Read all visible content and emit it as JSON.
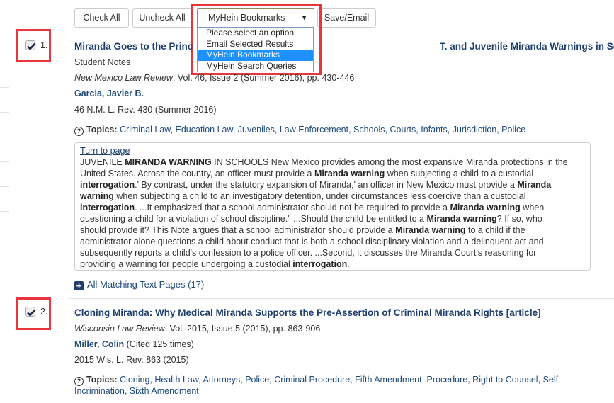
{
  "toolbar": {
    "check_all": "Check All",
    "uncheck_all": "Uncheck All",
    "select_value": "MyHein Bookmarks",
    "save_email": "Save/Email",
    "options": [
      {
        "label": "Please select an option",
        "selected": false
      },
      {
        "label": "Email Selected Results",
        "selected": false
      },
      {
        "label": "MyHein Bookmarks",
        "selected": true
      },
      {
        "label": "MyHein Search Queries",
        "selected": false
      }
    ]
  },
  "results": [
    {
      "number": "1.",
      "checked": true,
      "title": "Miranda Goes to the Principal's Office: The Supreme Court of New Mexico in State v. Antonio T. and Juvenile Miranda Warnings in Schools [notes]",
      "title_visible_left": "Miranda Goes to the Princ",
      "title_visible_right": "T. and Juvenile Miranda Warnings in Schools [notes]",
      "section": "Student Notes",
      "journal": "New Mexico Law Review",
      "journal_rest": ", Vol. 46, Issue 2 (Summer 2016), pp. 430-446",
      "author": "Garcia, Javier B.",
      "citation": "46 N.M. L. Rev. 430 (Summer 2016)",
      "topics_label": "Topics:",
      "topics": "Criminal Law, Education Law, Juveniles, Law Enforcement, Schools, Courts, Infants, Jurisdiction, Police",
      "turn_to_page": "Turn to page",
      "snippet_lines": [
        [
          [
            "JUVENILE ",
            false
          ],
          [
            "MIRANDA WARNING",
            true
          ],
          [
            " IN SCHOOLS New Mexico provides among the most expansive Miranda protections in the",
            false
          ]
        ],
        [
          [
            "United States. Across the country, an officer must provide a ",
            false
          ],
          [
            "Miranda warning",
            true
          ],
          [
            " when subjecting a child to a custodial",
            false
          ]
        ],
        [
          [
            "interrogation",
            true
          ],
          [
            ".' By contrast, under the statutory expansion of Miranda,' an officer in New Mexico must provide a ",
            false
          ],
          [
            "Miranda",
            true
          ]
        ],
        [
          [
            "warning",
            true
          ],
          [
            " when subjecting a child to an investigatory detention, under circumstances less coercive than a custodial",
            false
          ]
        ],
        [
          [
            "interrogation",
            true
          ],
          [
            ". ...It emphasized that a school administrator should not be required to provide a ",
            false
          ],
          [
            "Miranda warning",
            true
          ],
          [
            " when",
            false
          ]
        ],
        [
          [
            "questioning a child for a violation of school discipline.\" ...Should the child be entitled to a ",
            false
          ],
          [
            "Miranda warning",
            true
          ],
          [
            "? If so, who",
            false
          ]
        ],
        [
          [
            "should provide it? This Note argues that a school administrator should provide a ",
            false
          ],
          [
            "Miranda warning",
            true
          ],
          [
            " to a child if the",
            false
          ]
        ],
        [
          [
            "administrator alone questions a child about conduct that is both a school disciplinary violation and a delinquent act and",
            false
          ]
        ],
        [
          [
            "subsequently reports a child's confession to a police officer. ...Second, it discusses the Miranda Court's reasoning for",
            false
          ]
        ],
        [
          [
            "providing a warning for people undergoing a custodial ",
            false
          ],
          [
            "interrogation",
            true
          ],
          [
            ".",
            false
          ]
        ]
      ],
      "matching_pages": "All Matching Text Pages (17)"
    },
    {
      "number": "2.",
      "checked": true,
      "title": "Cloning Miranda: Why Medical Miranda Supports the Pre-Assertion of Criminal Miranda Rights [article]",
      "journal": "Wisconsin Law Review",
      "journal_rest": ", Vol. 2015, Issue 5 (2015), pp. 863-906",
      "author": "Miller, Colin",
      "cited": " (Cited 125 times)",
      "citation": "2015 Wis. L. Rev. 863 (2015)",
      "topics_label": "Topics:",
      "topics_line1": "Cloning, Health Law, Attorneys, Police, Criminal Procedure, Fifth Amendment, Procedure, Right to Counsel, Self-",
      "topics_line2": "Incrimination, Sixth Amendment"
    }
  ],
  "colors": {
    "title_blue": "#1e3f6e",
    "highlight_red": "#e8363c",
    "selected_option": "#1e90ff"
  }
}
